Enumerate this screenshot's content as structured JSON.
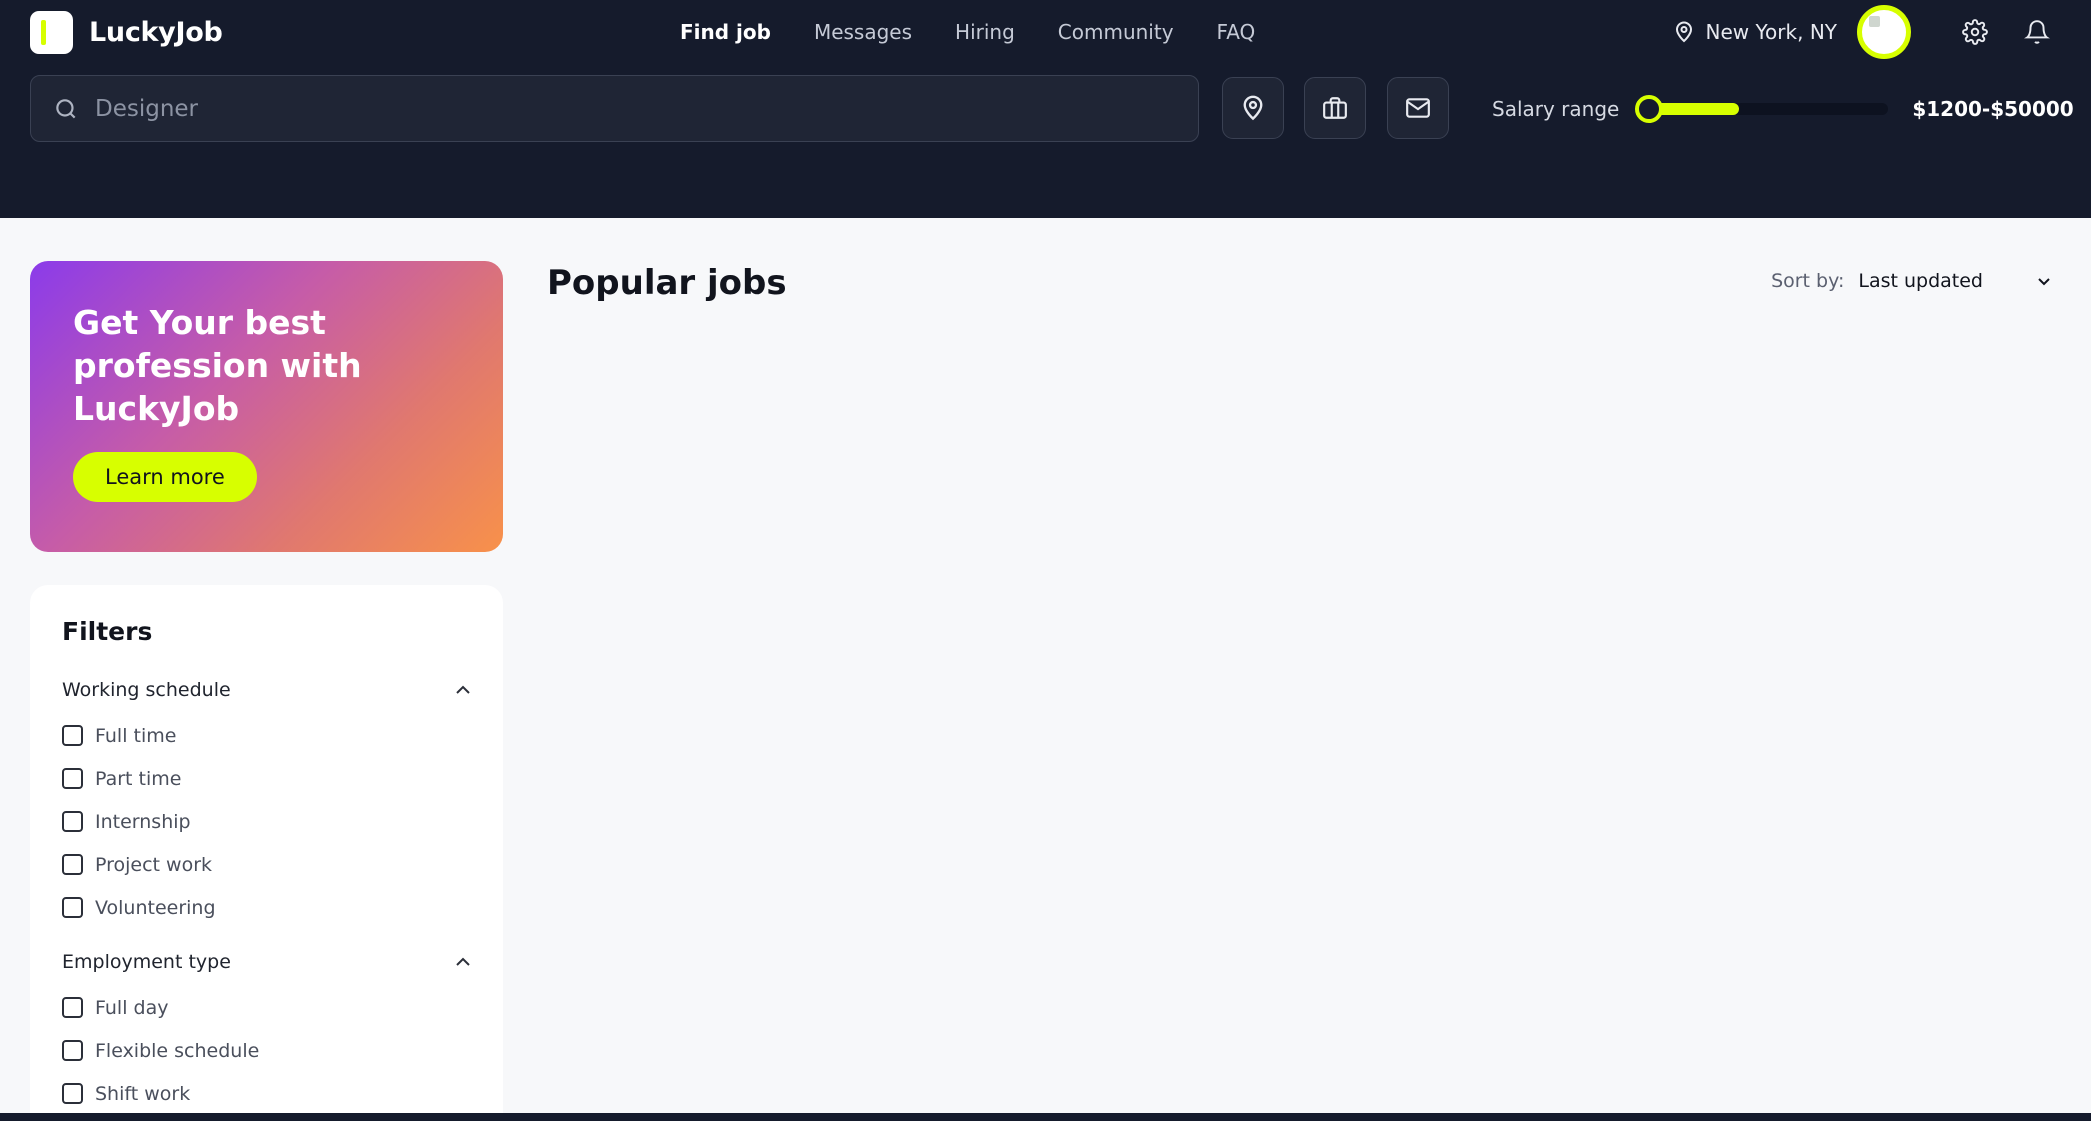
{
  "brand": {
    "name": "LuckyJob",
    "accent_color": "#d7ff00",
    "header_bg": "#151b2c"
  },
  "nav": {
    "items": [
      {
        "label": "Find job",
        "active": true
      },
      {
        "label": "Messages"
      },
      {
        "label": "Hiring"
      },
      {
        "label": "Community"
      },
      {
        "label": "FAQ"
      }
    ]
  },
  "user": {
    "location": "New York, NY",
    "icons": [
      "location-pin-icon",
      "settings-gear-icon",
      "notification-bell-icon"
    ]
  },
  "search": {
    "placeholder": "Designer",
    "value": ""
  },
  "toolbar_icons": [
    "location-pin-icon",
    "briefcase-icon",
    "mail-icon"
  ],
  "salary": {
    "label": "Salary range",
    "value": "$1200-$50000",
    "fill_fraction": 0.39
  },
  "promo": {
    "title": "Get Your best profession with LuckyJob",
    "button": "Learn more"
  },
  "filters": {
    "title": "Filters",
    "groups": [
      {
        "title": "Working schedule",
        "options": [
          "Full time",
          "Part time",
          "Internship",
          "Project work",
          "Volunteering"
        ]
      },
      {
        "title": "Employment type",
        "options": [
          "Full day",
          "Flexible schedule",
          "Shift work"
        ]
      }
    ]
  },
  "main": {
    "title": "Popular jobs",
    "sort_label": "Sort by:",
    "sort_value": "Last updated"
  }
}
